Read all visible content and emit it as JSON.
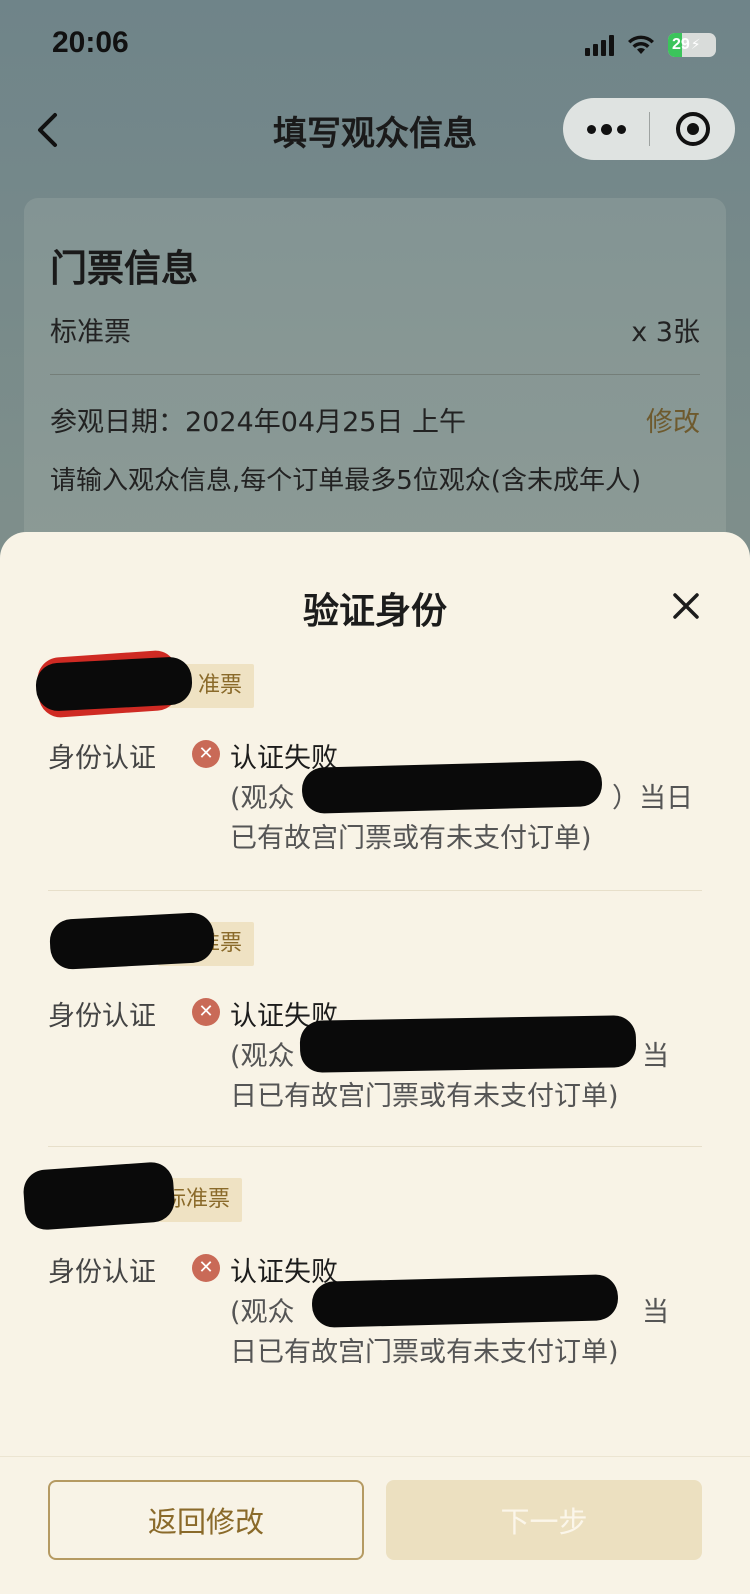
{
  "status_bar": {
    "time": "20:06",
    "battery_level": "29",
    "battery_percent": 29
  },
  "nav": {
    "title": "填写观众信息",
    "back_icon": "chevron-left-icon",
    "more_icon": "more-dots-icon",
    "close_miniapp_icon": "target-icon"
  },
  "ticket_info": {
    "title": "门票信息",
    "ticket_type": "标准票",
    "quantity": "x 3张",
    "visit_date": "参观日期：2024年04月25日 上午",
    "edit_label": "修改",
    "note": "请输入观众信息,每个订单最多5位观众(含未成年人)"
  },
  "sheet": {
    "title": "验证身份",
    "close_icon": "close-icon",
    "visitors": [
      {
        "badge": "准票",
        "label": "身份认证",
        "status": "认证失败",
        "msg_line1": "(观众",
        "msg_line1_tail": "）当日",
        "msg_line2": "已有故宫门票或有未支付订单)"
      },
      {
        "badge": "准票",
        "label": "身份认证",
        "status": "认证失败",
        "msg_line1": "(观众",
        "msg_line1_tail": "当",
        "msg_line2": "日已有故宫门票或有未支付订单)"
      },
      {
        "badge": "标准票",
        "label": "身份认证",
        "status": "认证失败",
        "msg_line1": "(观众",
        "msg_line1_tail": "当",
        "msg_line2": "日已有故宫门票或有未支付订单)"
      }
    ],
    "back_button": "返回修改",
    "next_button": "下一步"
  },
  "colors": {
    "sheet_bg": "#f8f3e6",
    "accent_gold": "#8a6a2a",
    "error": "#c96a57",
    "badge_bg": "#efe2c3"
  }
}
